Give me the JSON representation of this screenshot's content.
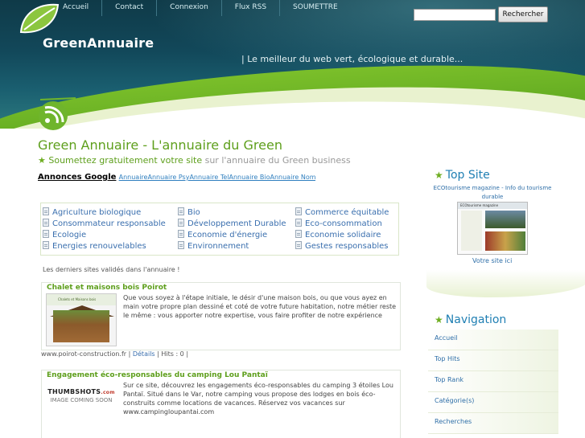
{
  "header": {
    "nav": [
      "Accueil",
      "Contact",
      "Connexion",
      "Flux RSS",
      "SOUMETTRE"
    ],
    "search_button": "Rechercher",
    "site_title": "GreenAnnuaire",
    "tagline": "| Le meilleur du web vert, écologique et durable..."
  },
  "main": {
    "title": "Green Annuaire - L'annuaire du Green",
    "subtitle_link": "Soumettez gratuitement votre site",
    "subtitle_rest": " sur l'annuaire du Green business",
    "ads_label": "Annonces Google",
    "ads_links": "AnnuaireAnnuaire PsyAnnuaire TelAnnuaire BioAnnuaire Nom",
    "categories": [
      [
        "Agriculture biologique",
        "Bio",
        "Commerce équitable"
      ],
      [
        "Consommateur responsable",
        "Développement Durable",
        "Eco-consommation"
      ],
      [
        "Ecologie",
        "Economie d'énergie",
        "Economie solidaire"
      ],
      [
        "Energies renouvelables",
        "Environnement",
        "Gestes responsables"
      ]
    ],
    "recent_label": "Les derniers sites validés dans l'annuaire !",
    "sites": [
      {
        "title": "Chalet et maisons bois Poirot",
        "description": "Que vous soyez à l'étape initiale, le désir d'une maison bois, ou que vous ayez en main votre propre plan dessiné et coté de votre future habitation, notre métier reste le même : vous apporter notre expertise, vous faire profiter de notre expérience",
        "thumb_caption": "Chalets et Maisons bois",
        "footer_url": "www.poirot-construction.fr | ",
        "footer_details": "Détails",
        "footer_hits": " | Hits : 0 |"
      },
      {
        "title": "Engagement éco-responsables du camping Lou Pantaï",
        "description": "Sur ce site, découvrez les engagements éco-responsables du camping 3 étoiles Lou Pantaï. Situé dans le Var, notre camping vous propose des lodges en bois éco-construits comme locations de vacances. Réservez vos vacances sur www.campingloupantai.com",
        "thumb_brand": "THUMBSHOTS",
        "thumb_brand_suffix": ".com",
        "thumb_message": "IMAGE COMING SOON"
      }
    ]
  },
  "sidebar": {
    "top_site_heading": "Top Site",
    "top_site_name": "ECOtourisme magazine - Info du tourisme durable",
    "top_site_thumb_header": "ECOtourisme magazine",
    "vote_label": "Votre site ici",
    "navigation_heading": "Navigation",
    "navigation_items": [
      "Accueil",
      "Top Hits",
      "Top Rank",
      "Catégorie(s)",
      "Recherches"
    ]
  },
  "colors": {
    "header_dark": "#0f3a48",
    "green_accent": "#5e9f1c",
    "link_blue": "#2f6fa8"
  }
}
